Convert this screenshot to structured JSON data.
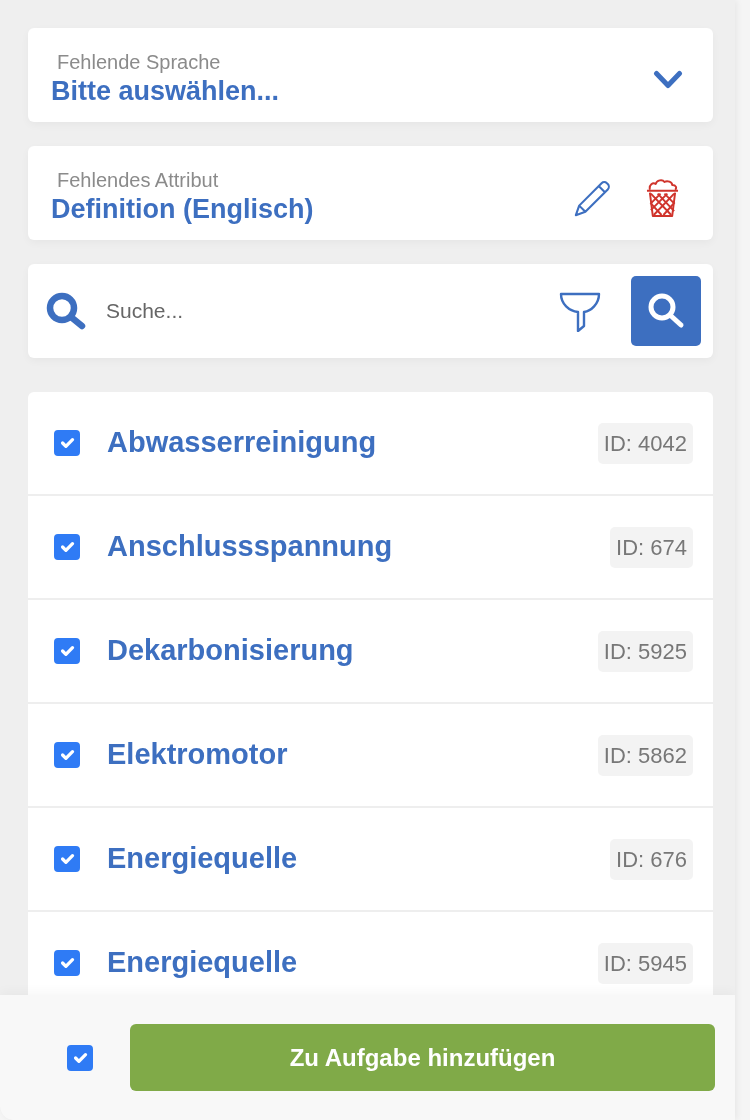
{
  "language_select": {
    "label": "Fehlende Sprache",
    "value": "Bitte auswählen..."
  },
  "attribute": {
    "label": "Fehlendes Attribut",
    "value": "Definition (Englisch)"
  },
  "search": {
    "placeholder": "Suche..."
  },
  "items": [
    {
      "title": "Abwasserreinigung",
      "id": "ID: 4042",
      "checked": true
    },
    {
      "title": "Anschlussspannung",
      "id": "ID: 674",
      "checked": true
    },
    {
      "title": "Dekarbonisierung",
      "id": "ID: 5925",
      "checked": true
    },
    {
      "title": "Elektromotor",
      "id": "ID: 5862",
      "checked": true
    },
    {
      "title": "Energiequelle",
      "id": "ID: 676",
      "checked": true
    },
    {
      "title": "Energiequelle",
      "id": "ID: 5945",
      "checked": true
    }
  ],
  "footer": {
    "select_all_checked": true,
    "button": "Zu Aufgabe hinzufügen"
  }
}
